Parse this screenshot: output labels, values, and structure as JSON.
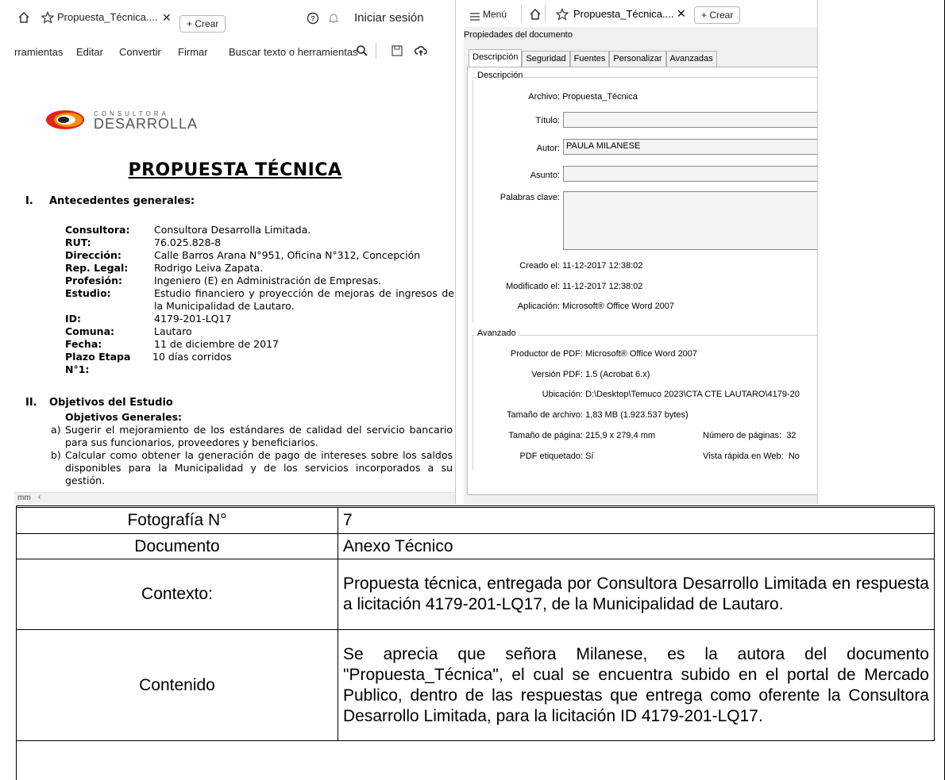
{
  "left_viewer": {
    "tabbar": {
      "tab_title": "Propuesta_Técnica....",
      "new_tab_label": "+ Crear",
      "signin_label": "Iniciar sesión"
    },
    "menubar": {
      "items": [
        "rramientas",
        "Editar",
        "Convertir",
        "Firmar"
      ],
      "search_label": "Buscar texto o herramientas"
    },
    "document": {
      "logo_small": "CONSULTORA",
      "logo_big": "DESARROLLA",
      "title": "PROPUESTA TÉCNICA",
      "section1_num": "I.",
      "section1_title": "Antecedentes generales:",
      "fields": [
        {
          "label": "Consultora:",
          "value": "Consultora Desarrolla Limitada."
        },
        {
          "label": "RUT:",
          "value": "76.025.828-8"
        },
        {
          "label": "Dirección:",
          "value": "Calle Barros Arana N°951, Oficina N°312, Concepción"
        },
        {
          "label": "Rep. Legal:",
          "value": "Rodrigo Leiva Zapata."
        },
        {
          "label": "Profesión:",
          "value": "Ingeniero (E) en Administración de Empresas."
        },
        {
          "label": "Estudio:",
          "value": "Estudio financiero y proyección de mejoras de ingresos de la Municipalidad de Lautaro."
        },
        {
          "label": "ID:",
          "value": "4179-201-LQ17"
        },
        {
          "label": "Comuna:",
          "value": "Lautaro"
        },
        {
          "label": "Fecha:",
          "value": "11 de diciembre de 2017"
        },
        {
          "label": "Plazo Etapa N°1:",
          "value": "10 días corridos"
        }
      ],
      "section2_num": "II.",
      "section2_title": "Objetivos del Estudio",
      "objectives_heading": "Objetivos Generales:",
      "objectives": [
        {
          "letter": "a)",
          "text": "Sugerir el mejoramiento de los estándares de calidad del servicio bancario para sus funcionarios, proveedores y beneficiarios."
        },
        {
          "letter": "b)",
          "text": "Calcular como obtener la generación de pago de intereses sobre los saldos disponibles para la Municipalidad y de los servicios incorporados a su gestión."
        }
      ]
    },
    "scroll_label": "mm"
  },
  "right_viewer": {
    "tabbar": {
      "menu_label": "Menú",
      "tab_title": "Propuesta_Técnica....",
      "new_tab_label": "+ Crear"
    },
    "dialog_title": "Propiedades del documento",
    "tabs": [
      "Descripción",
      "Seguridad",
      "Fuentes",
      "Personalizar",
      "Avanzadas"
    ],
    "description_group": "Descripción",
    "description": {
      "archivo_label": "Archivo:",
      "archivo_value": "Propuesta_Técnica",
      "titulo_label": "Título:",
      "titulo_value": "",
      "autor_label": "Autor:",
      "autor_value": "PAULA MILANESE",
      "asunto_label": "Asunto:",
      "asunto_value": "",
      "palabras_label": "Palabras clave:",
      "palabras_value": "",
      "creado_label": "Creado el:",
      "creado_value": "11-12-2017 12:38:02",
      "modificado_label": "Modificado el:",
      "modificado_value": "11-12-2017 12:38:02",
      "aplicacion_label": "Aplicación:",
      "aplicacion_value": "Microsoft® Office Word 2007"
    },
    "advanced_group": "Avanzado",
    "advanced": {
      "productor_label": "Productor de PDF:",
      "productor_value": "Microsoft® Office Word 2007",
      "version_label": "Versión PDF:",
      "version_value": "1.5 (Acrobat 6.x)",
      "ubicacion_label": "Ubicación:",
      "ubicacion_value": "D:\\Desktop\\Temuco 2023\\CTA CTE LAUTARO\\4179-20",
      "tamano_archivo_label": "Tamaño de archivo:",
      "tamano_archivo_value": "1,83 MB (1.923.537 bytes)",
      "tamano_pagina_label": "Tamaño de página:",
      "tamano_pagina_value": "215,9 x 279,4 mm",
      "num_paginas_label": "Número de páginas:",
      "num_paginas_value": "32",
      "etiquetado_label": "PDF etiquetado:",
      "etiquetado_value": "Sí",
      "vista_rapida_label": "Vista rápida en Web:",
      "vista_rapida_value": "No"
    }
  },
  "table": {
    "rows": [
      {
        "label": "Fotografía N°",
        "value": "7"
      },
      {
        "label": "Documento",
        "value": "Anexo Técnico"
      },
      {
        "label": "Contexto:",
        "value": "Propuesta técnica, entregada por Consultora Desarrollo Limitada en respuesta a licitación 4179-201-LQ17, de la Municipalidad de Lautaro."
      },
      {
        "label": "Contenido",
        "value": "Se aprecia que señora Milanese, es la autora del documento \"Propuesta_Técnica\", el cual se encuentra subido en el portal de Mercado Publico, dentro de las respuestas que entrega como oferente la Consultora Desarrollo Limitada, para la licitación ID 4179-201-LQ17."
      }
    ]
  },
  "colors": {
    "logo_red": "#e2231a",
    "logo_orange": "#f39200",
    "dialog_bg": "#f0f0f0"
  }
}
